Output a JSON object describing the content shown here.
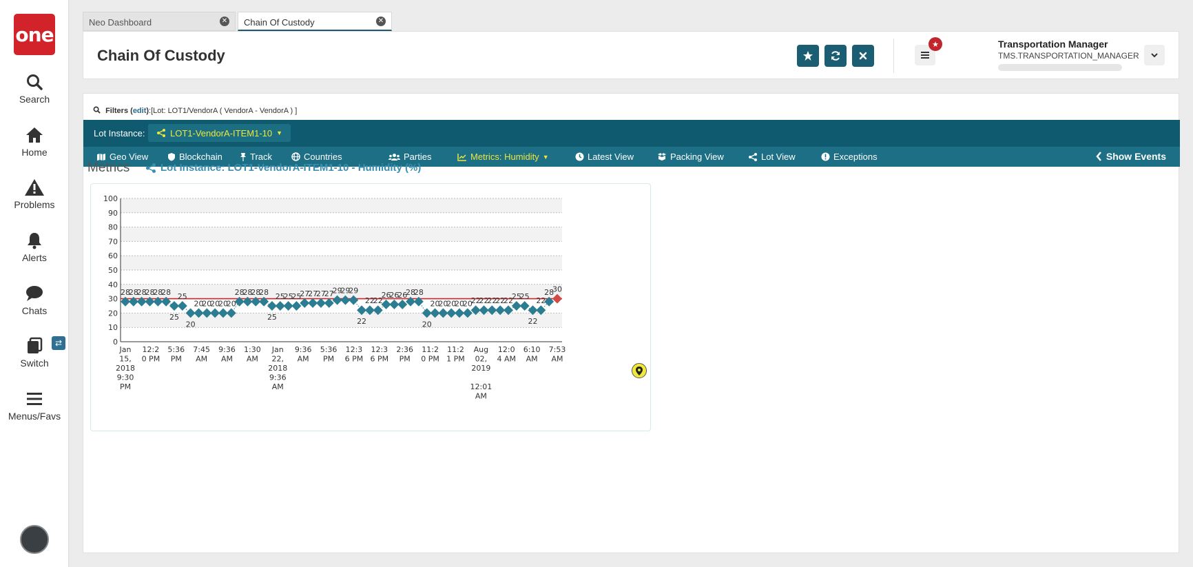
{
  "nav": {
    "logo": "one",
    "items": [
      {
        "label": "Search",
        "icon": "search-icon"
      },
      {
        "label": "Home",
        "icon": "home-icon"
      },
      {
        "label": "Problems",
        "icon": "warning-icon"
      },
      {
        "label": "Alerts",
        "icon": "bell-icon"
      },
      {
        "label": "Chats",
        "icon": "chat-icon"
      },
      {
        "label": "Switch",
        "icon": "switch-icon"
      },
      {
        "label": "Menus/Favs",
        "icon": "menu-icon"
      }
    ],
    "switch_badge": "⇄"
  },
  "tabs": [
    {
      "label": "Neo Dashboard",
      "active": false
    },
    {
      "label": "Chain Of Custody",
      "active": true
    }
  ],
  "header": {
    "title": "Chain Of Custody",
    "user_name": "Transportation Manager",
    "user_role": "TMS.TRANSPORTATION_MANAGER"
  },
  "filters": {
    "label": "Filters",
    "edit": "edit",
    "value": ":[Lot: LOT1/VendorA ( VendorA - VendorA ) ]"
  },
  "lot": {
    "label": "Lot Instance:",
    "value": "LOT1-VendorA-ITEM1-10"
  },
  "toolbar": {
    "items": [
      {
        "label": "Geo View",
        "icon": "map-icon"
      },
      {
        "label": "Blockchain",
        "icon": "shield-icon"
      },
      {
        "label": "Track",
        "icon": "pin-icon"
      },
      {
        "label": "Countries",
        "icon": "globe-icon"
      },
      {
        "label": "Parties",
        "icon": "users-icon"
      },
      {
        "label": "Metrics: Humidity",
        "icon": "chart-icon",
        "active": true
      },
      {
        "label": "Latest View",
        "icon": "clock-icon"
      },
      {
        "label": "Packing View",
        "icon": "boxes-icon"
      },
      {
        "label": "Lot View",
        "icon": "share-icon"
      },
      {
        "label": "Exceptions",
        "icon": "exclamation-icon"
      }
    ],
    "show_events": "Show Events"
  },
  "metrics": {
    "title": "Metrics",
    "subtitle": "Lot Instance: LOT1-VendorA-ITEM1-10 - Humidity (%)"
  },
  "colors": {
    "point": "#2d7d92",
    "last_point": "#d24a45",
    "threshold": "#c9262b",
    "teal_dark": "#0f5a6e",
    "teal": "#1c6f84",
    "highlight": "#f0e63c"
  },
  "chart_data": {
    "type": "scatter",
    "ylim": [
      0,
      100
    ],
    "yticks": [
      0,
      10,
      20,
      30,
      40,
      50,
      60,
      70,
      80,
      90,
      100
    ],
    "threshold": 30,
    "grid": true,
    "values": [
      28,
      28,
      28,
      28,
      28,
      28,
      25,
      25,
      20,
      20,
      20,
      20,
      20,
      20,
      28,
      28,
      28,
      28,
      25,
      25,
      25,
      25,
      27,
      27,
      27,
      27,
      29,
      29,
      29,
      22,
      22,
      22,
      26,
      26,
      26,
      28,
      28,
      20,
      20,
      20,
      20,
      20,
      20,
      22,
      22,
      22,
      22,
      22,
      25,
      25,
      22,
      22,
      28,
      30
    ],
    "x_tick_labels": [
      [
        "Jan",
        "15,",
        "2018",
        "9:30",
        "PM"
      ],
      [
        "12:2",
        "0 PM"
      ],
      [
        "5:36",
        "PM"
      ],
      [
        "7:45",
        "AM"
      ],
      [
        "9:36",
        "AM"
      ],
      [
        "1:30",
        "AM"
      ],
      [
        "Jan",
        "22,",
        "2018",
        "9:36",
        "AM"
      ],
      [
        "9:36",
        "AM"
      ],
      [
        "5:36",
        "PM"
      ],
      [
        "12:3",
        "6 PM"
      ],
      [
        "12:3",
        "6 PM"
      ],
      [
        "2:36",
        "PM"
      ],
      [
        "11:2",
        "0 PM"
      ],
      [
        "11:2",
        "1 PM"
      ],
      [
        "Aug",
        "02,",
        "2019",
        "",
        "12:01",
        "AM"
      ],
      [
        "12:0",
        "4 AM"
      ],
      [
        "6:10",
        "AM"
      ],
      [
        "7:53",
        "AM"
      ]
    ]
  }
}
